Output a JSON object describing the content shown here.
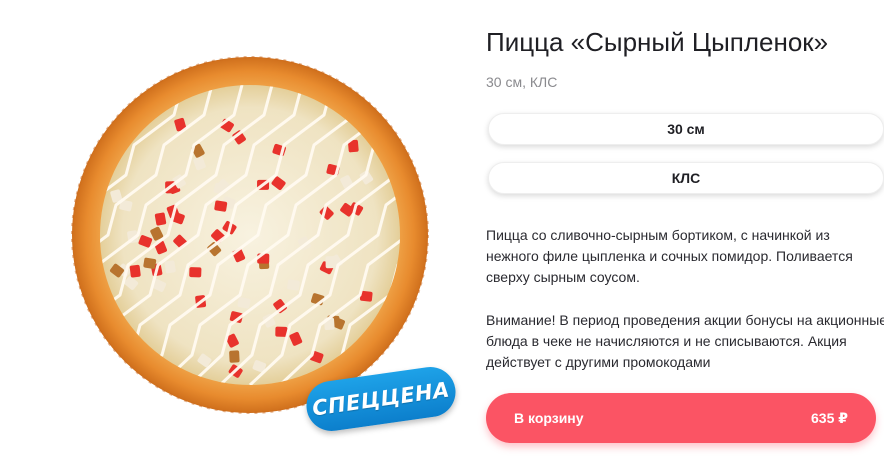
{
  "product": {
    "title": "Пицца «Сырный Цыпленок»",
    "subtitle": "30 см, КЛС",
    "badge": "СПЕЦЦЕНА",
    "options": {
      "size": "30 см",
      "dough": "КЛС"
    },
    "description": "Пицца со сливочно-сырным бортиком, с начинкой из нежного филе цыпленка и сочных помидор. Поливается сверху сырным соусом.",
    "notice": "Внимание! В период проведения акции бонусы на акционные блюда в чеке не начисляются и не списываются. Акция действует с другими промокодами",
    "cart_button": {
      "label": "В корзину",
      "price": "635 ₽"
    }
  },
  "colors": {
    "accent": "#fb5464",
    "badge": "#1493dd",
    "crust": "#e8953a",
    "cheese": "#f5edd7",
    "tomato": "#e8322c"
  }
}
